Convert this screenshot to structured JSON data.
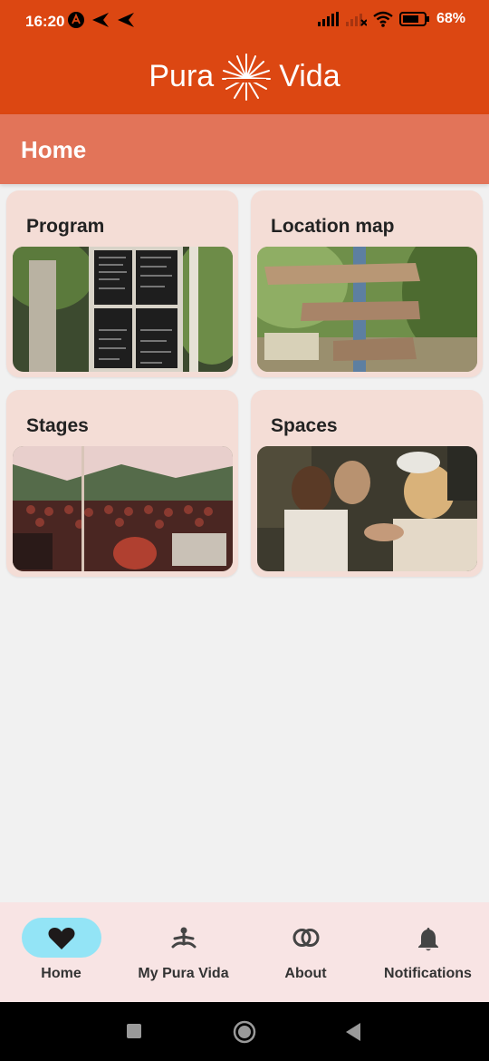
{
  "status": {
    "time": "16:20",
    "battery": "68%"
  },
  "app": {
    "brand_left": "Pura",
    "brand_right": "Vida"
  },
  "page": {
    "title": "Home"
  },
  "cards": [
    {
      "title": "Program"
    },
    {
      "title": "Location map"
    },
    {
      "title": "Stages"
    },
    {
      "title": "Spaces"
    }
  ],
  "nav": [
    {
      "label": "Home",
      "icon": "heart-icon",
      "active": true
    },
    {
      "label": "My Pura Vida",
      "icon": "meditation-icon",
      "active": false
    },
    {
      "label": "About",
      "icon": "rings-icon",
      "active": false
    },
    {
      "label": "Notifications",
      "icon": "bell-icon",
      "active": false
    }
  ],
  "colors": {
    "brand": "#dc4712",
    "page_bar": "#e27459",
    "card_bg": "#f4ddd6",
    "nav_bg": "#f8e4e4",
    "active_pill": "#93e4f6"
  }
}
